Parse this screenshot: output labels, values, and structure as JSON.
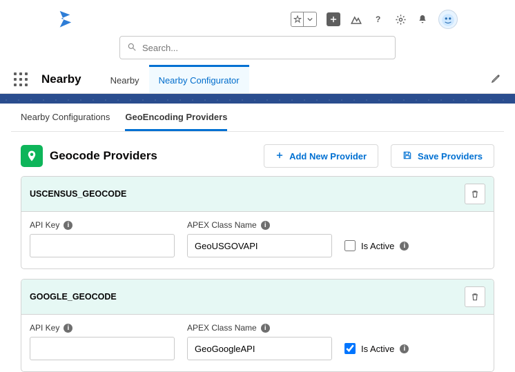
{
  "search": {
    "placeholder": "Search..."
  },
  "appName": "Nearby",
  "navTabs": [
    {
      "label": "Nearby",
      "active": false
    },
    {
      "label": "Nearby Configurator",
      "active": true
    }
  ],
  "subTabs": [
    {
      "label": "Nearby Configurations",
      "active": false
    },
    {
      "label": "GeoEncoding Providers",
      "active": true
    }
  ],
  "sectionTitle": "Geocode Providers",
  "buttons": {
    "add": "Add New Provider",
    "save": "Save Providers"
  },
  "fieldLabels": {
    "apiKey": "API Key",
    "apexClass": "APEX Class Name",
    "isActive": "Is Active"
  },
  "providers": [
    {
      "name": "USCENSUS_GEOCODE",
      "apiKey": "",
      "apexClass": "GeoUSGOVAPI",
      "isActive": false
    },
    {
      "name": "GOOGLE_GEOCODE",
      "apiKey": "",
      "apexClass": "GeoGoogleAPI",
      "isActive": true
    }
  ]
}
